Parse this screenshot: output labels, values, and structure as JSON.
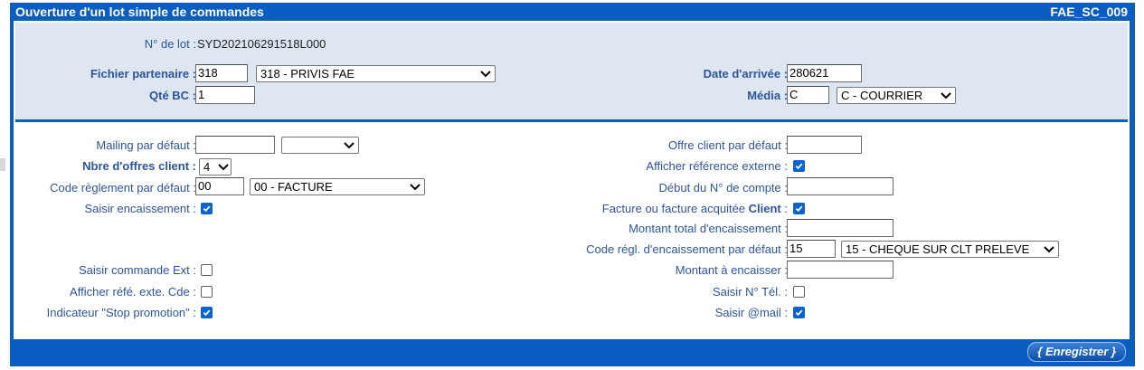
{
  "window": {
    "title": "Ouverture d'un lot simple de commandes",
    "code": "FAE_SC_009"
  },
  "top": {
    "lot_label": "N° de lot :",
    "lot_value": "SYD202106291518L000",
    "fichier_label": "Fichier partenaire :",
    "fichier_code": "318",
    "fichier_select": "318 - PRIVIS FAE",
    "qte_label": "Qté BC :",
    "qte_value": "1",
    "date_label": "Date d'arrivée :",
    "date_value": "280621",
    "media_label": "Média :",
    "media_code": "C",
    "media_select": "C - COURRIER"
  },
  "left": {
    "mailing_label": "Mailing par défaut :",
    "mailing_value": "",
    "mailing_select": "",
    "nbre_label": "Nbre d'offres client :",
    "nbre_select": "4",
    "code_regl_label": "Code règlement par défaut :",
    "code_regl_value": "00",
    "code_regl_select": "00 - FACTURE",
    "saisir_enc_label": "Saisir encaissement :",
    "saisir_enc_checked": true,
    "saisir_cmd_label": "Saisir commande Ext :",
    "saisir_cmd_checked": false,
    "afficher_ref_label": "Afficher réfé. exte. Cde :",
    "afficher_ref_checked": false,
    "stop_promo_label": "Indicateur \"Stop promotion\" :",
    "stop_promo_checked": true
  },
  "right": {
    "offre_label": "Offre client par défaut :",
    "offre_value": "",
    "afficher_ext_label": "Afficher référence externe :",
    "afficher_ext_checked": true,
    "debut_label": "Début du N° de compte :",
    "debut_value": "",
    "facture_label_a": "Facture ou facture acquitée ",
    "facture_label_b": "Client",
    "facture_label_c": " :",
    "facture_checked": true,
    "montant_total_label": "Montant total d'encaissement :",
    "montant_total_value": "",
    "code_enc_label": "Code régl. d'encaissement par défaut :",
    "code_enc_value": "15",
    "code_enc_select": "15 - CHEQUE SUR CLT PRELEVE",
    "montant_enc_label": "Montant à encaisser :",
    "montant_enc_value": "",
    "saisir_tel_label": "Saisir N° Tél. :",
    "saisir_tel_checked": false,
    "saisir_mail_label": "Saisir @mail :",
    "saisir_mail_checked": true
  },
  "footer": {
    "save_label": "{ Enregistrer }"
  },
  "colors": {
    "frame_blue": "#0a5ec2",
    "top_panel": "#dde6f1",
    "label_blue": "#2f5597",
    "checkbox_blue": "#0b63ce"
  },
  "icons": {
    "select_arrow": "chevron-down-icon",
    "checkbox": "checkmark-icon"
  }
}
